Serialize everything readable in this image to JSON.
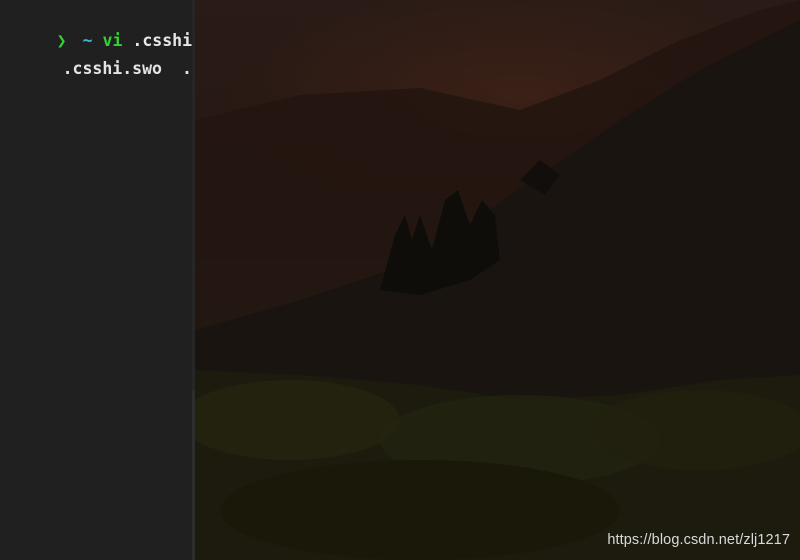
{
  "terminal": {
    "prompt_symbol": "❯",
    "prompt_dir": "~",
    "command": "vi",
    "argument": ".csshi.sw",
    "files": [
      ".csshi.swo",
      ".csshi.swp"
    ]
  },
  "watermark": "https://blog.csdn.net/zlj1217",
  "colors": {
    "terminal_bg": "#202020",
    "prompt_green": "#35d035",
    "dir_cyan": "#3cb8d6",
    "text": "#e3e3e3"
  }
}
